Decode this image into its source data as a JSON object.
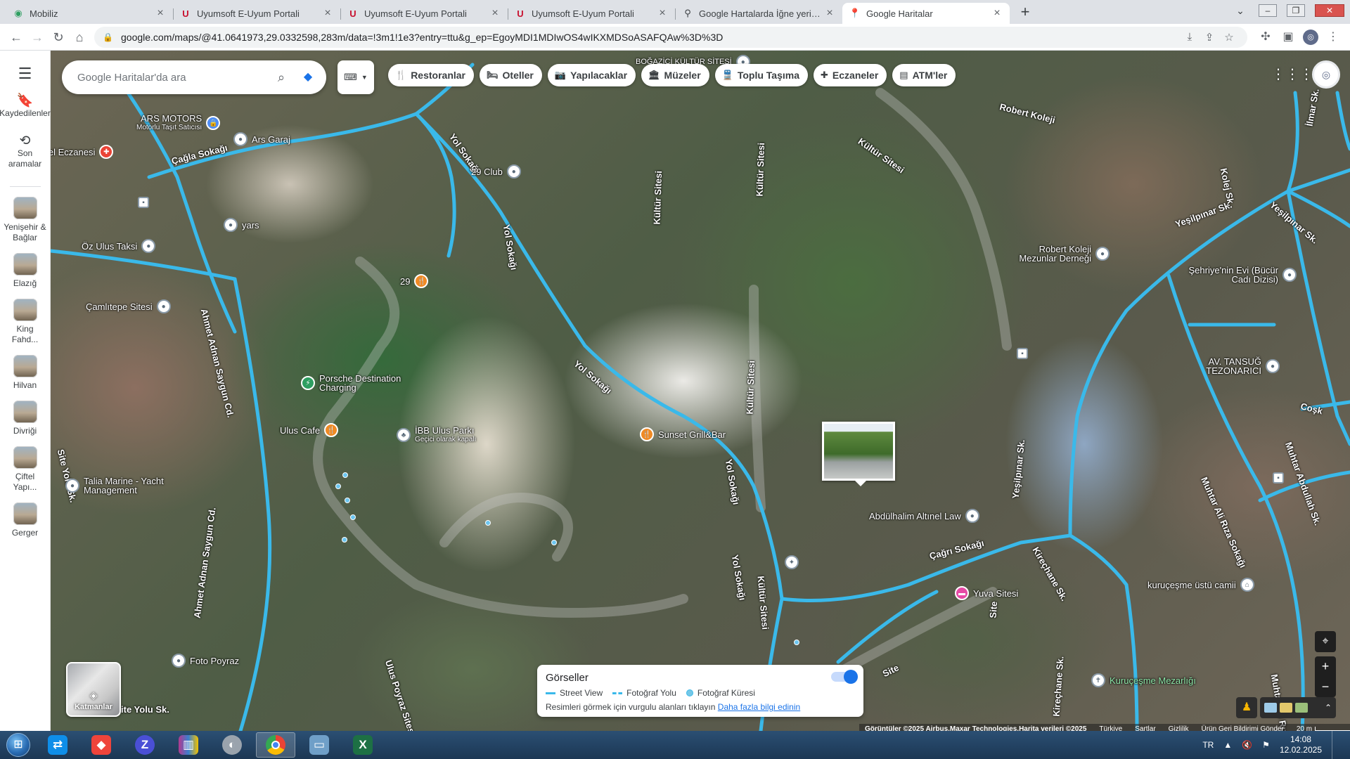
{
  "browser": {
    "tabs": [
      {
        "title": "Mobiliz",
        "icon": "mobiliz-icon",
        "active": false
      },
      {
        "title": "Uyumsoft E-Uyum Portali",
        "icon": "uyumsoft-icon",
        "active": false
      },
      {
        "title": "Uyumsoft E-Uyum Portali",
        "icon": "uyumsoft-icon",
        "active": false
      },
      {
        "title": "Uyumsoft E-Uyum Portali",
        "icon": "uyumsoft-icon",
        "active": false
      },
      {
        "title": "Google Hartalarda İğne yerine Çe",
        "icon": "article-icon",
        "active": false
      },
      {
        "title": "Google Haritalar",
        "icon": "maps-icon",
        "active": true
      }
    ],
    "new_tab": "+",
    "url": "google.com/maps/@41.0641973,29.0332598,283m/data=!3m1!1e3?entry=ttu&g_ep=EgoyMDI1MDIwOS4wIKXMDSoASAFQAw%3D%3D"
  },
  "maps": {
    "rail": {
      "saved_label": "Kaydedilenler",
      "recent_label": "Son aramalar",
      "recent_places": [
        "Yenişehir & Bağlar",
        "Elazığ",
        "King Fahd...",
        "Hilvan",
        "Divriği",
        "Çiftel Yapı...",
        "Gerger"
      ]
    },
    "search": {
      "placeholder": "Google Haritalar'da ara"
    },
    "chips": [
      "Restoranlar",
      "Oteller",
      "Yapılacaklar",
      "Müzeler",
      "Toplu Taşıma",
      "Eczaneler",
      "ATM'ler"
    ],
    "road_labels": [
      "Çağla Sokağı",
      "Yol Sokağı",
      "Yol Sokağı",
      "Yol Sokağı",
      "Yol Sokağı",
      "Yol Sokağı",
      "Kültür Sitesi",
      "Kültür Sitesi",
      "Kültür Sitesi",
      "Kültür Sitesi",
      "Kültür Sitesi",
      "Ahmet Adnan Saygun Cd.",
      "Ahmet Adnan Saygun Cd.",
      "Yeşilpınar Sk.",
      "Yeşilpınar Sk.",
      "Yeşilpınar Sk.",
      "Çağrı Sokağı",
      "Kireçhane Sk.",
      "Muhtar Ali Rıza Sokağı",
      "Muhtar Abdullah Sk.",
      "Muhtar Ali Rıza Sk.",
      "Kolej Sk.",
      "Site Yolu Sk.",
      "Site",
      "Site",
      "Ulus Poyraz Sitesi",
      "Robert Koleji",
      "Kireçhane Sk.",
      "İlmar Sk.",
      "Coşk",
      "ite Yolu Sk."
    ],
    "pois": [
      {
        "name": "ARS MOTORS",
        "sub": "Motorlu Taşıt Satıcısı"
      },
      {
        "name": "Ars Garaj",
        "sub": ""
      },
      {
        "name": "iel Eczanesi",
        "sub": ""
      },
      {
        "name": "29 Club",
        "sub": ""
      },
      {
        "name": "yars",
        "sub": ""
      },
      {
        "name": "Öz Ulus Taksi",
        "sub": ""
      },
      {
        "name": "29",
        "sub": ""
      },
      {
        "name": "Çamlıtepe Sitesi",
        "sub": ""
      },
      {
        "name": "Porsche Destination Charging",
        "sub": ""
      },
      {
        "name": "Ulus Cafe",
        "sub": ""
      },
      {
        "name": "İBB Ulus Parkı",
        "sub": "Geçici olarak kapalı"
      },
      {
        "name": "Sunset Grill&Bar",
        "sub": ""
      },
      {
        "name": "Talia Marine - Yacht Management",
        "sub": ""
      },
      {
        "name": "Foto Poyraz",
        "sub": ""
      },
      {
        "name": "Robert Koleji Mezunlar Derneği",
        "sub": ""
      },
      {
        "name": "Şehriye'nin Evi (Bücür Cadı Dizisi)",
        "sub": ""
      },
      {
        "name": "AV. TANSUĞ TEZONARICI",
        "sub": ""
      },
      {
        "name": "Abdülhalim Altınel Law",
        "sub": ""
      },
      {
        "name": "Yuva Sitesi",
        "sub": ""
      },
      {
        "name": "kuruçeşme üstü camii",
        "sub": ""
      },
      {
        "name": "Kuruçeşme Mezarlığı",
        "sub": ""
      },
      {
        "name": "BOĞAZİÇİ KÜLTÜR SİTESİ",
        "sub": ""
      }
    ],
    "layers_label": "Katmanlar",
    "imagery_panel": {
      "title": "Görseller",
      "legend": [
        "Street View",
        "Fotoğraf Yolu",
        "Fotoğraf Küresi"
      ],
      "note": "Resimleri görmek için vurgulu alanları tıklayın",
      "link": "Daha fazla bilgi edinin"
    },
    "attribution": {
      "imagery": "Görüntüler ©2025 Airbus,Maxar Technologies,Harita verileri ©2025",
      "links": [
        "Türkiye",
        "Şartlar",
        "Gizlilik",
        "Ürün Geri Bildirimi Gönder"
      ],
      "scale": "20 m"
    }
  },
  "taskbar": {
    "apps": [
      "teamviewer",
      "anydesk",
      "zoom",
      "winrar",
      "mozilla-pro",
      "chrome",
      "file-explorer",
      "excel"
    ],
    "lang": "TR",
    "time": "14:08",
    "date": "12.02.2025"
  },
  "colors": {
    "road": "#3ab9ea",
    "accent": "#1a73e8",
    "taskbar": "#1c3754"
  }
}
